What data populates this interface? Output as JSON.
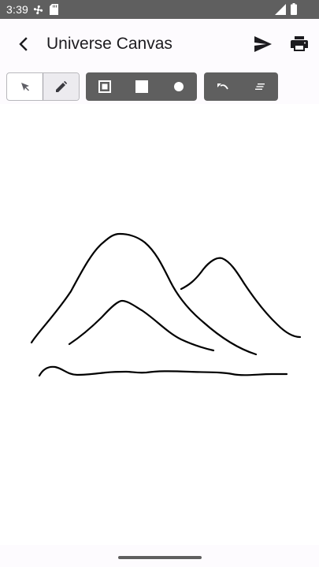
{
  "status_bar": {
    "time": "3:39",
    "icons": [
      "fan-icon",
      "sd-card-icon",
      "signal-icon",
      "battery-icon"
    ]
  },
  "app_bar": {
    "title": "Universe Canvas",
    "back_icon": "arrow-back-icon",
    "actions": [
      {
        "name": "send",
        "icon": "send-icon"
      },
      {
        "name": "print",
        "icon": "print-icon"
      }
    ]
  },
  "toolbar": {
    "mode_group": [
      {
        "name": "select",
        "icon": "pointer-arrow-icon",
        "selected": false
      },
      {
        "name": "draw",
        "icon": "pencil-icon",
        "selected": true
      }
    ],
    "shape_group": [
      {
        "name": "outlined-rectangle",
        "icon": "outlined-square-icon"
      },
      {
        "name": "filled-rectangle",
        "icon": "filled-square-icon"
      },
      {
        "name": "circle",
        "icon": "filled-circle-icon"
      }
    ],
    "edit_group": [
      {
        "name": "undo",
        "icon": "undo-icon"
      },
      {
        "name": "clear",
        "icon": "clear-lines-icon"
      }
    ]
  },
  "canvas": {
    "content": "hand-drawn mountains sketch",
    "stroke_color": "#000000",
    "background": "#ffffff"
  },
  "colors": {
    "status_bar": "#5f5f5f",
    "toolbar_dark": "#5f5f5f",
    "toggle_selected": "#ecebef",
    "page_background": "#fdfbfe"
  }
}
